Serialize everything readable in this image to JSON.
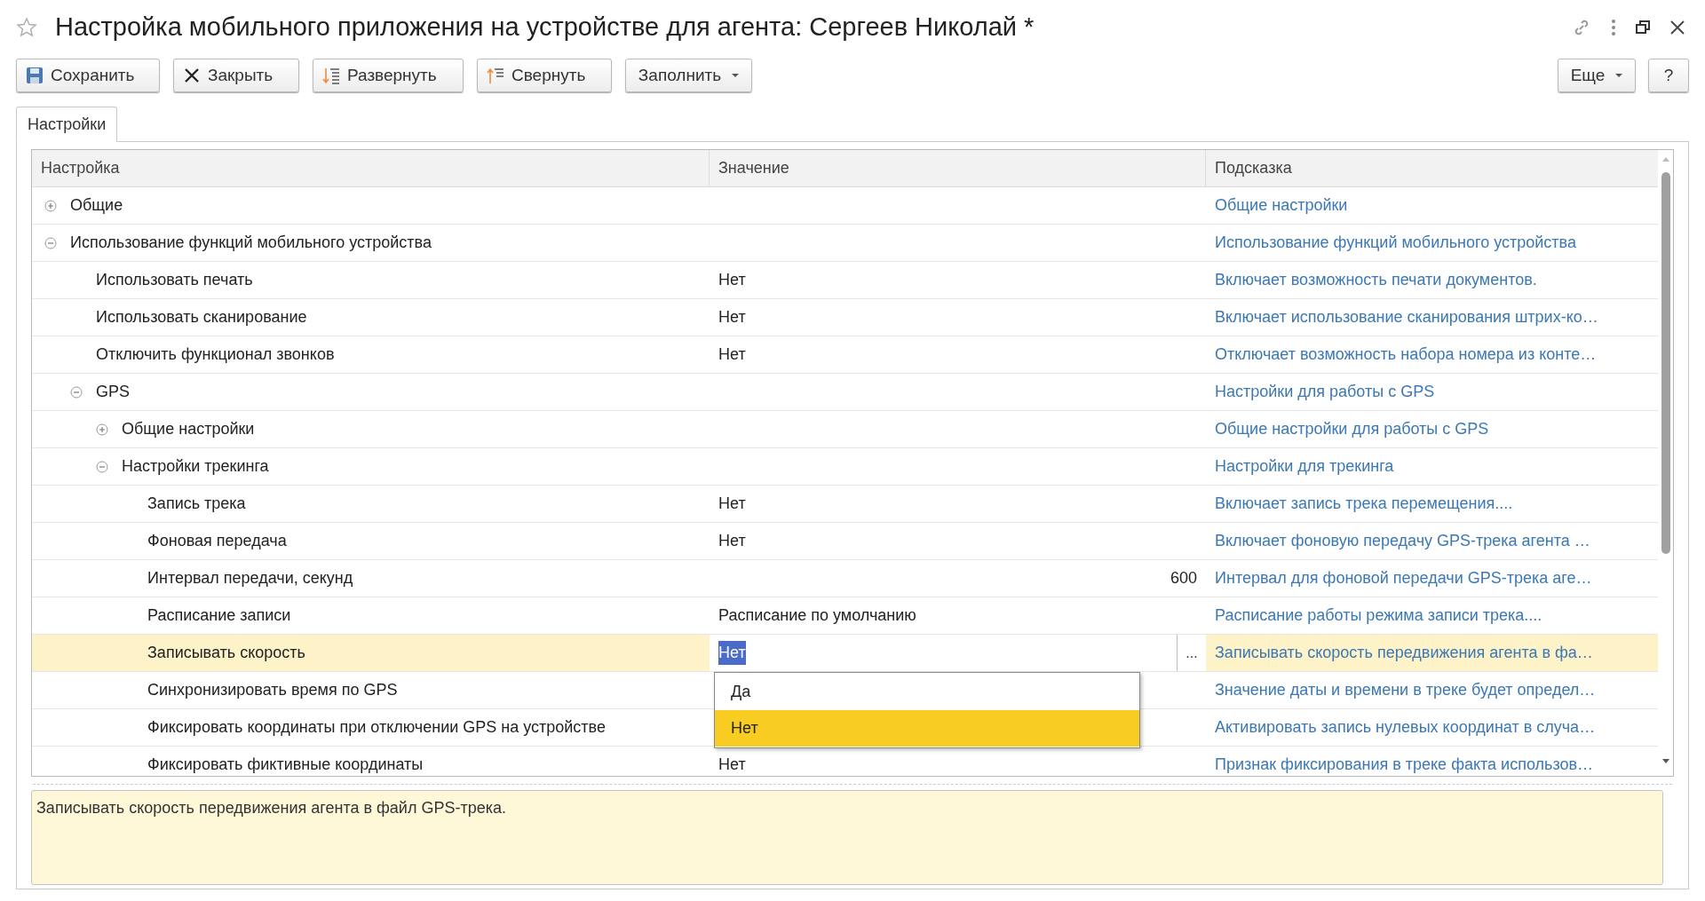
{
  "window": {
    "title": "Настройка мобильного приложения на устройстве для агента: Сергеев Николай *"
  },
  "toolbar": {
    "buttons": [
      {
        "label": "Сохранить",
        "dropdown": false
      },
      {
        "label": "Закрыть",
        "dropdown": false
      },
      {
        "label": "Развернуть",
        "dropdown": false
      },
      {
        "label": "Свернуть",
        "dropdown": false
      },
      {
        "label": "Заполнить",
        "dropdown": true
      }
    ],
    "right_buttons": [
      {
        "label": "Еще",
        "dropdown": true
      },
      {
        "label": "?",
        "dropdown": false
      }
    ]
  },
  "tabs": [
    {
      "label": "Настройки",
      "selected": true
    }
  ],
  "table": {
    "columns": [
      "Настройка",
      "Значение",
      "Подсказка"
    ],
    "rows": [
      {
        "label": "Общие",
        "hint": "Общие настройки",
        "expanded": false,
        "selected": false
      },
      {
        "label": "Использование функций мобильного устройства",
        "hint": "Использование функций мобильного устройства",
        "expanded": true,
        "selected": false,
        "children": [
          {
            "label": "Использовать печать",
            "value": "Нет",
            "hint": "Включает возможность печати документов.",
            "selected": false
          },
          {
            "label": "Использовать сканирование",
            "value": "Нет",
            "hint": "Включает использование сканирования штрих-ко…",
            "selected": false
          },
          {
            "label": "Отключить функционал звонков",
            "value": "Нет",
            "hint": "Отключает возможность набора номера из конте…",
            "selected": false
          },
          {
            "label": "GPS",
            "hint": "Настройки для работы с GPS",
            "expanded": true,
            "selected": false,
            "children": [
              {
                "label": "Общие настройки",
                "hint": "Общие настройки для работы с GPS",
                "expanded": false,
                "selected": false
              },
              {
                "label": "Настройки трекинга",
                "hint": "Настройки для трекинга",
                "expanded": true,
                "selected": false,
                "children": [
                  {
                    "label": "Запись трека",
                    "value": "Нет",
                    "hint": "Включает запись трека перемещения....",
                    "selected": false
                  },
                  {
                    "label": "Фоновая передача",
                    "value": "Нет",
                    "hint": "Включает фоновую передачу GPS-трека агента …",
                    "selected": false
                  },
                  {
                    "label": "Интервал передачи, секунд",
                    "value": "600",
                    "kind": "number",
                    "hint": "Интервал для фоновой передачи GPS-трека аге…",
                    "selected": false
                  },
                  {
                    "label": "Расписание записи",
                    "value": "Расписание по умолчанию",
                    "hint": "Расписание работы режима записи трека....",
                    "selected": false
                  },
                  {
                    "label": "Записывать скорость",
                    "value": "Нет",
                    "hint": "Записывать скорость передвижения агента в фа…",
                    "selected": true,
                    "editing": true,
                    "choice_button": "...",
                    "options": [
                      {
                        "label": "Да",
                        "selected": false
                      },
                      {
                        "label": "Нет",
                        "selected": true
                      }
                    ]
                  },
                  {
                    "label": "Синхронизировать время по GPS",
                    "hint": "Значение даты и времени в треке будет определ…",
                    "selected": false
                  },
                  {
                    "label": "Фиксировать координаты при отключении GPS на устройстве",
                    "hint": "Активировать запись нулевых координат в случа…",
                    "selected": false
                  },
                  {
                    "label": "Фиксировать фиктивные координаты",
                    "value": "Нет",
                    "hint": "Признак фиксирования в треке факта использов…",
                    "selected": false
                  }
                ]
              }
            ]
          }
        ]
      }
    ]
  },
  "description": "Записывать скорость передвижения агента в файл GPS-трека."
}
